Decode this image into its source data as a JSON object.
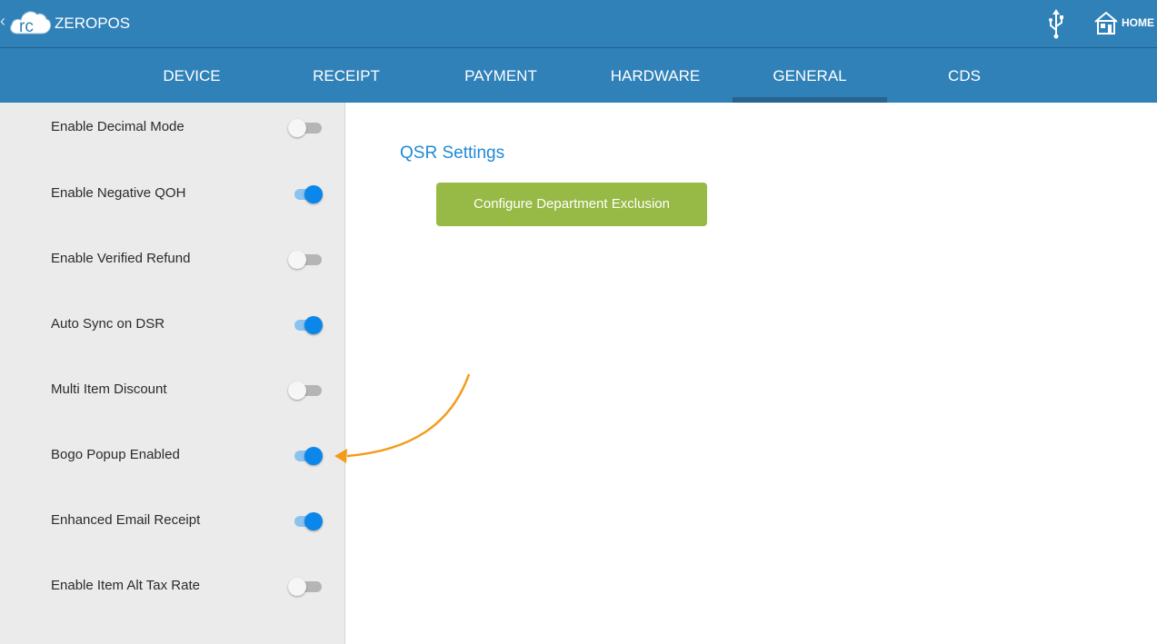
{
  "titlebar": {
    "logo_text": "rc",
    "app_title": "ZEROPOS",
    "home_label": "HOME"
  },
  "tabs": [
    {
      "label": "DEVICE",
      "active": false
    },
    {
      "label": "RECEIPT",
      "active": false
    },
    {
      "label": "PAYMENT",
      "active": false
    },
    {
      "label": "HARDWARE",
      "active": false
    },
    {
      "label": "GENERAL",
      "active": true
    },
    {
      "label": "CDS",
      "active": false
    }
  ],
  "settings": [
    {
      "label": "Enable Decimal Mode",
      "enabled": false
    },
    {
      "label": "Enable Negative QOH",
      "enabled": true
    },
    {
      "label": "Enable Verified Refund",
      "enabled": false
    },
    {
      "label": "Auto Sync on DSR",
      "enabled": true
    },
    {
      "label": "Multi Item Discount",
      "enabled": false
    },
    {
      "label": "Bogo Popup Enabled",
      "enabled": true
    },
    {
      "label": "Enhanced Email Receipt",
      "enabled": true
    },
    {
      "label": "Enable Item Alt Tax Rate",
      "enabled": false
    }
  ],
  "qsr": {
    "title": "QSR Settings",
    "button_label": "Configure Department Exclusion"
  },
  "colors": {
    "header_blue": "#3181b9",
    "active_tab_indicator": "#27638d",
    "toggle_on": "#0b86ea",
    "button_green": "#97b945",
    "section_title_blue": "#1f8ad6",
    "annotation_orange": "#f39c1b"
  },
  "icons": {
    "back": "chevron-left-icon",
    "logo": "cloud-logo-icon",
    "usb": "usb-icon",
    "home": "home-icon"
  }
}
